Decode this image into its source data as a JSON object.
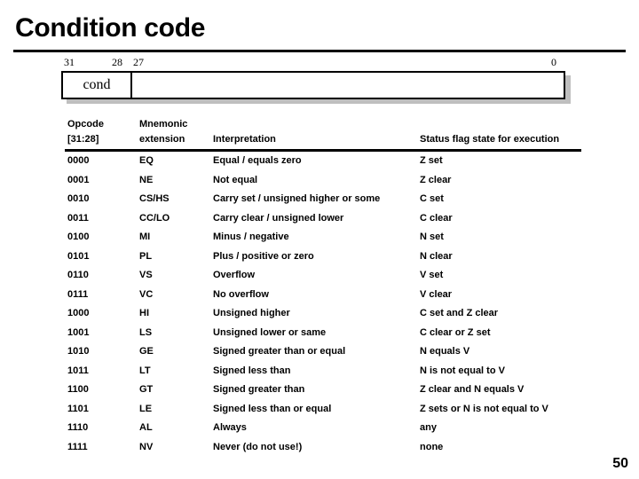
{
  "slide": {
    "title": "Condition code",
    "page_number": "50"
  },
  "bitfield": {
    "labels": {
      "bit31": "31",
      "bit28": "28",
      "bit27": "27",
      "bit0": "0"
    },
    "cond_field_label": "cond"
  },
  "table": {
    "headers": {
      "opcode_line1": "Opcode",
      "opcode_line2": "[31:28]",
      "mnemonic_line1": "Mnemonic",
      "mnemonic_line2": "extension",
      "interpretation": "Interpretation",
      "status": "Status flag state for execution"
    },
    "rows": [
      {
        "opcode": "0000",
        "mnemonic": "EQ",
        "interpretation": "Equal / equals zero",
        "flags": "Z set"
      },
      {
        "opcode": "0001",
        "mnemonic": "NE",
        "interpretation": "Not equal",
        "flags": "Z clear"
      },
      {
        "opcode": "0010",
        "mnemonic": "CS/HS",
        "interpretation": "Carry set / unsigned higher or some",
        "flags": "C set"
      },
      {
        "opcode": "0011",
        "mnemonic": "CC/LO",
        "interpretation": "Carry clear / unsigned lower",
        "flags": "C clear"
      },
      {
        "opcode": "0100",
        "mnemonic": "MI",
        "interpretation": "Minus / negative",
        "flags": "N set"
      },
      {
        "opcode": "0101",
        "mnemonic": "PL",
        "interpretation": "Plus / positive or zero",
        "flags": "N clear"
      },
      {
        "opcode": "0110",
        "mnemonic": "VS",
        "interpretation": "Overflow",
        "flags": "V set"
      },
      {
        "opcode": "0111",
        "mnemonic": "VC",
        "interpretation": "No overflow",
        "flags": "V clear"
      },
      {
        "opcode": "1000",
        "mnemonic": "HI",
        "interpretation": "Unsigned higher",
        "flags": "C set and Z clear"
      },
      {
        "opcode": "1001",
        "mnemonic": "LS",
        "interpretation": "Unsigned lower or same",
        "flags": "C clear or Z set"
      },
      {
        "opcode": "1010",
        "mnemonic": "GE",
        "interpretation": "Signed greater than or equal",
        "flags": "N equals V"
      },
      {
        "opcode": "1011",
        "mnemonic": "LT",
        "interpretation": "Signed less than",
        "flags": "N is not equal to V"
      },
      {
        "opcode": "1100",
        "mnemonic": "GT",
        "interpretation": "Signed greater than",
        "flags": "Z clear and N equals V"
      },
      {
        "opcode": "1101",
        "mnemonic": "LE",
        "interpretation": "Signed less than or equal",
        "flags": "Z sets or N is not equal to V"
      },
      {
        "opcode": "1110",
        "mnemonic": "AL",
        "interpretation": "Always",
        "flags": "any"
      },
      {
        "opcode": "1111",
        "mnemonic": "NV",
        "interpretation": "Never (do not use!)",
        "flags": "none"
      }
    ]
  },
  "colors": {
    "text": "#000000",
    "background": "#ffffff",
    "rule": "#000000",
    "box_shadow": "#bfbfbf"
  }
}
